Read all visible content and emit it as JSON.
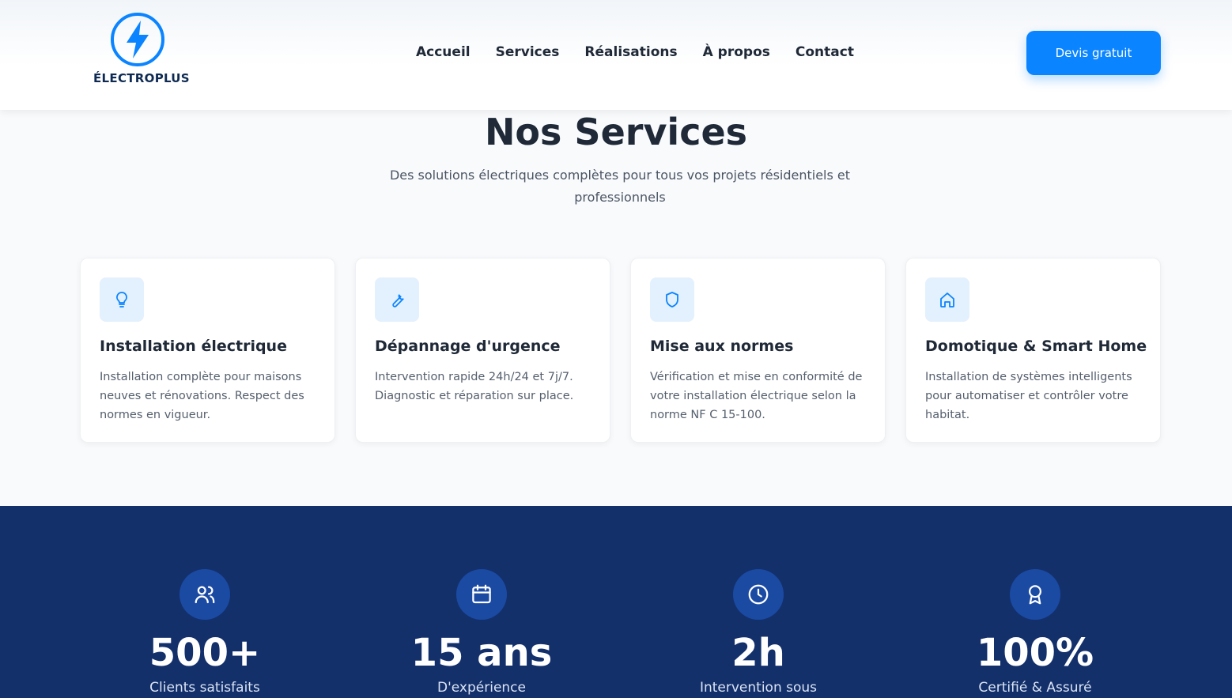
{
  "brand": {
    "name": "ÉLECTROPLUS",
    "logo_icon": "lightning-bolt-icon",
    "accent": "#0a84ff",
    "dark": "#0f2a52"
  },
  "nav": {
    "items": [
      "Accueil",
      "Services",
      "Réalisations",
      "À propos",
      "Contact"
    ]
  },
  "header": {
    "cta_label": "Devis gratuit"
  },
  "services": {
    "title": "Nos Services",
    "subtitle": "Des solutions électriques complètes pour tous vos projets résidentiels et professionnels",
    "cards": [
      {
        "icon": "lightbulb-icon",
        "title": "Installation électrique",
        "description": "Installation complète pour maisons neuves et rénovations. Respect des normes en vigueur."
      },
      {
        "icon": "wrench-icon",
        "title": "Dépannage d'urgence",
        "description": "Intervention rapide 24h/24 et 7j/7. Diagnostic et réparation sur place."
      },
      {
        "icon": "shield-icon",
        "title": "Mise aux normes",
        "description": "Vérification et mise en conformité de votre installation électrique selon la norme NF C 15-100."
      },
      {
        "icon": "home-icon",
        "title": "Domotique & Smart Home",
        "description": "Installation de systèmes intelligents pour automatiser et contrôler votre habitat."
      }
    ]
  },
  "stats": {
    "background": "#13306b",
    "items": [
      {
        "icon": "users-icon",
        "value": "500+",
        "label": "Clients satisfaits"
      },
      {
        "icon": "calendar-icon",
        "value": "15 ans",
        "label": "D'expérience"
      },
      {
        "icon": "clock-icon",
        "value": "2h",
        "label": "Intervention sous"
      },
      {
        "icon": "award-icon",
        "value": "100%",
        "label": "Certifié & Assuré"
      }
    ]
  }
}
